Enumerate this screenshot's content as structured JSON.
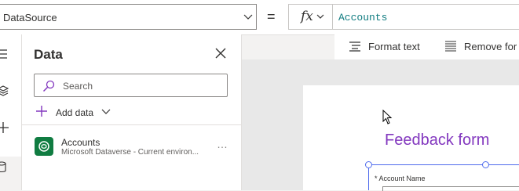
{
  "formula_bar": {
    "property_value": "DataSource",
    "equals": "=",
    "fx_label": "fx",
    "formula": "Accounts"
  },
  "format_toolbar": {
    "format_text": "Format text",
    "remove_formatting": "Remove for"
  },
  "data_panel": {
    "title": "Data",
    "search_placeholder": "Search",
    "add_data_label": "Add data",
    "sources": [
      {
        "name": "Accounts",
        "subtitle": "Microsoft Dataverse - Current environ...",
        "more": "…"
      }
    ]
  },
  "canvas": {
    "form_title": "Feedback form",
    "field_label": "* Account Name"
  },
  "colors": {
    "accent": "#4f6bed",
    "form_title": "#8338bf",
    "formula_text": "#107c80",
    "dataverse": "#107c41"
  }
}
